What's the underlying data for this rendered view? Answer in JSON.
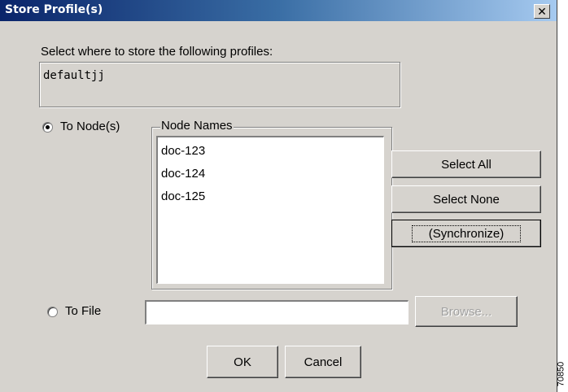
{
  "dialog": {
    "title": "Store Profile(s)",
    "close_glyph": "✕"
  },
  "prompt": "Select where to store the following profiles:",
  "profiles_text": "defaultjj",
  "to_node": {
    "label": "To Node(s)",
    "selected": true
  },
  "node_group": {
    "legend": "Node Names",
    "items": [
      "doc-123",
      "doc-124",
      "doc-125"
    ]
  },
  "buttons": {
    "select_all": "Select All",
    "select_none": "Select None",
    "synchronize": "(Synchronize)",
    "browse": "Browse...",
    "ok": "OK",
    "cancel": "Cancel"
  },
  "to_file": {
    "label": "To File",
    "selected": false,
    "value": ""
  },
  "figure_id": "70850"
}
